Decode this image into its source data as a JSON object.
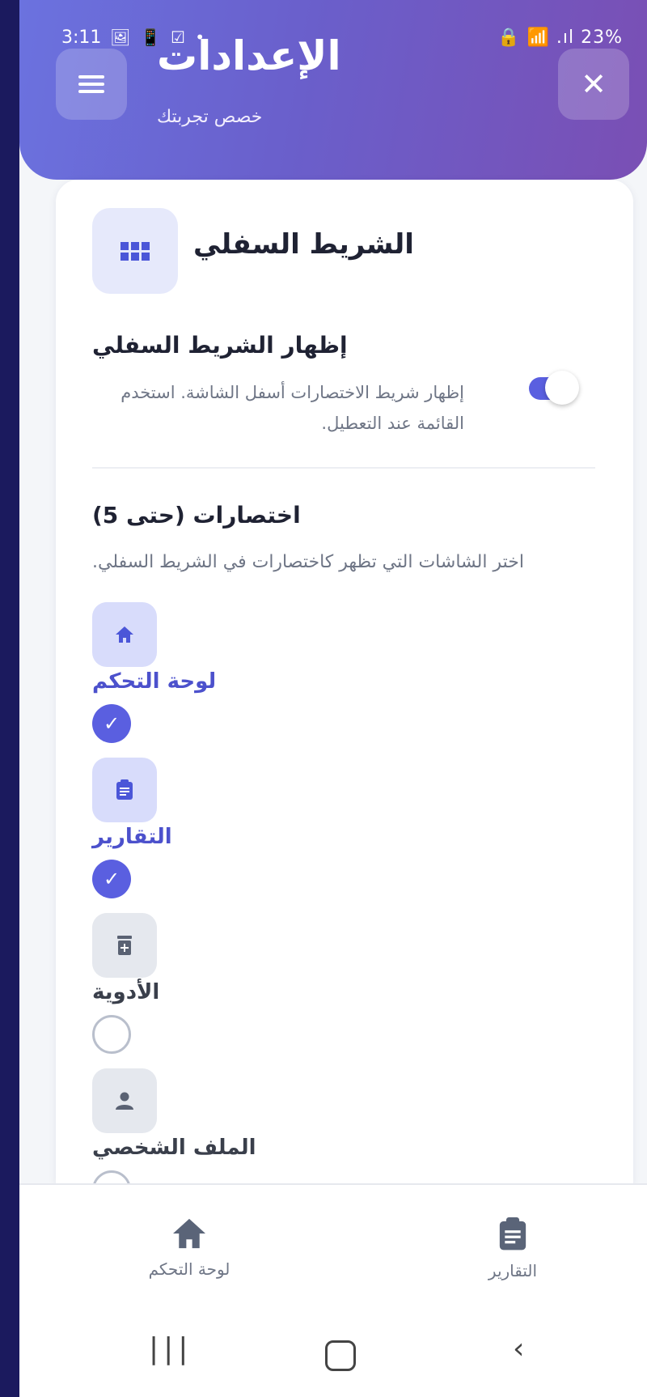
{
  "status_bar": {
    "time": "3:11",
    "left_icons": "🖼 📱 ☑ •",
    "right": "🔒 📶 .ıl 23%"
  },
  "header": {
    "title": "الإعدادات",
    "subtitle": "خصص تجربتك"
  },
  "section": {
    "title": "الشريط السفلي",
    "toggle_title": "إظهار الشريط السفلي",
    "toggle_desc": "إظهار شريط الاختصارات أسفل الشاشة. استخدم القائمة عند التعطيل.",
    "toggle_on": true,
    "shortcuts_title": "اختصارات (حتى 5)",
    "shortcuts_desc": "اختر الشاشات التي تظهر كاختصارات في الشريط السفلي.",
    "items": [
      {
        "label": "لوحة التحكم",
        "icon": "home-icon",
        "checked": true
      },
      {
        "label": "التقارير",
        "icon": "clipboard-icon",
        "checked": true
      },
      {
        "label": "الأدوية",
        "icon": "medicine-icon",
        "checked": false
      },
      {
        "label": "الملف الشخصي",
        "icon": "person-icon",
        "checked": false
      }
    ]
  },
  "bottom_nav": {
    "home_label": "لوحة التحكم",
    "reports_label": "التقارير"
  },
  "colors": {
    "accent": "#5a5fe0",
    "header_start": "#6b72df",
    "header_end": "#7a4fb4"
  }
}
